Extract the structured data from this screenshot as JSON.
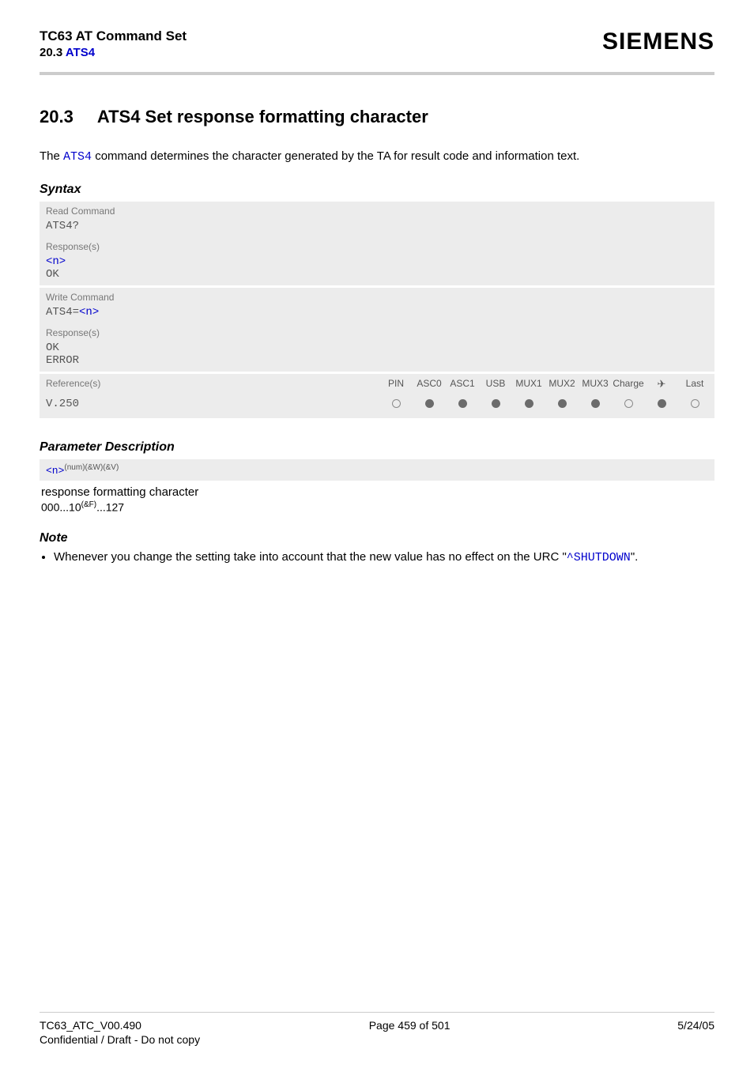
{
  "header": {
    "title": "TC63 AT Command Set",
    "section_prefix": "20.3 ",
    "section_link": "ATS4",
    "brand": "SIEMENS"
  },
  "section": {
    "number": "20.3",
    "title": "ATS4   Set response formatting character"
  },
  "intro": {
    "pre": "The ",
    "cmd": "ATS4",
    "post": " command determines the character generated by the TA for result code and information text."
  },
  "syntax": {
    "heading": "Syntax",
    "read_label": "Read Command",
    "read_cmd": "ATS4?",
    "read_resp_label": "Response(s)",
    "read_resp_line1": "<n>",
    "read_resp_line2": "OK",
    "write_label": "Write Command",
    "write_cmd_pre": "ATS4=",
    "write_cmd_arg": "<n>",
    "write_resp_label": "Response(s)",
    "write_resp_line1": "OK",
    "write_resp_line2": "ERROR"
  },
  "refs": {
    "label": "Reference(s)",
    "value": "V.250",
    "cols": [
      "PIN",
      "ASC0",
      "ASC1",
      "USB",
      "MUX1",
      "MUX2",
      "MUX3",
      "Charge",
      "✈",
      "Last"
    ],
    "dots": [
      "empty",
      "filled",
      "filled",
      "filled",
      "filled",
      "filled",
      "filled",
      "empty",
      "filled",
      "empty"
    ]
  },
  "param": {
    "heading": "Parameter Description",
    "name": "<n>",
    "tags": "(num)(&W)(&V)",
    "desc": "response formatting character",
    "range_pre": "000...10",
    "range_sup": "(&F)",
    "range_post": "...127"
  },
  "note": {
    "heading": "Note",
    "text_pre": "Whenever you change the setting take into account that the new value has no effect on the URC \"",
    "link": "^SHUTDOWN",
    "text_post": "\"."
  },
  "footer": {
    "left": "TC63_ATC_V00.490",
    "center": "Page 459 of 501",
    "right": "5/24/05",
    "sub": "Confidential / Draft - Do not copy"
  }
}
